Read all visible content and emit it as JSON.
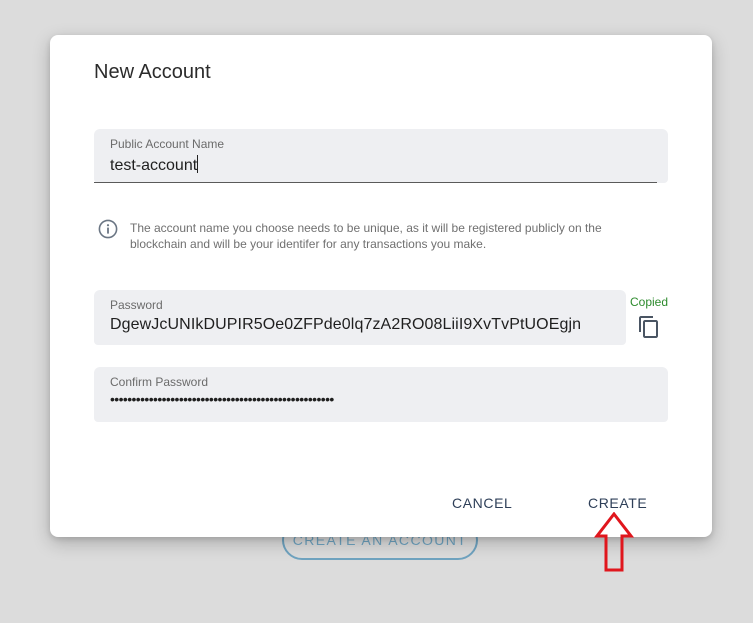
{
  "background": {
    "create_account_label": "CREATE AN ACCOUNT"
  },
  "dialog": {
    "title": "New Account",
    "public_name": {
      "label": "Public Account Name",
      "value": "test-account"
    },
    "info": {
      "icon": "info-icon",
      "text": "The account name you choose needs to be unique, as it will be registered publicly on the blockchain and will be your identifer for any transactions you make."
    },
    "password": {
      "label": "Password",
      "value": "DgewJcUNIkDUPIR5Oe0ZFPde0lq7zA2RO08LiiI9XvTvPtUOEgjn",
      "copied_status": "Copied",
      "copy_icon": "copy-icon"
    },
    "confirm_password": {
      "label": "Confirm Password",
      "value": "••••••••••••••••••••••••••••••••••••••••••••••••••••"
    },
    "actions": {
      "cancel_label": "CANCEL",
      "create_label": "CREATE"
    }
  },
  "annotation": {
    "arrow_color": "#e0161d"
  },
  "colors": {
    "accent": "#6fa3c0",
    "copied": "#2e8b2e",
    "button_text": "#2e3f58"
  }
}
